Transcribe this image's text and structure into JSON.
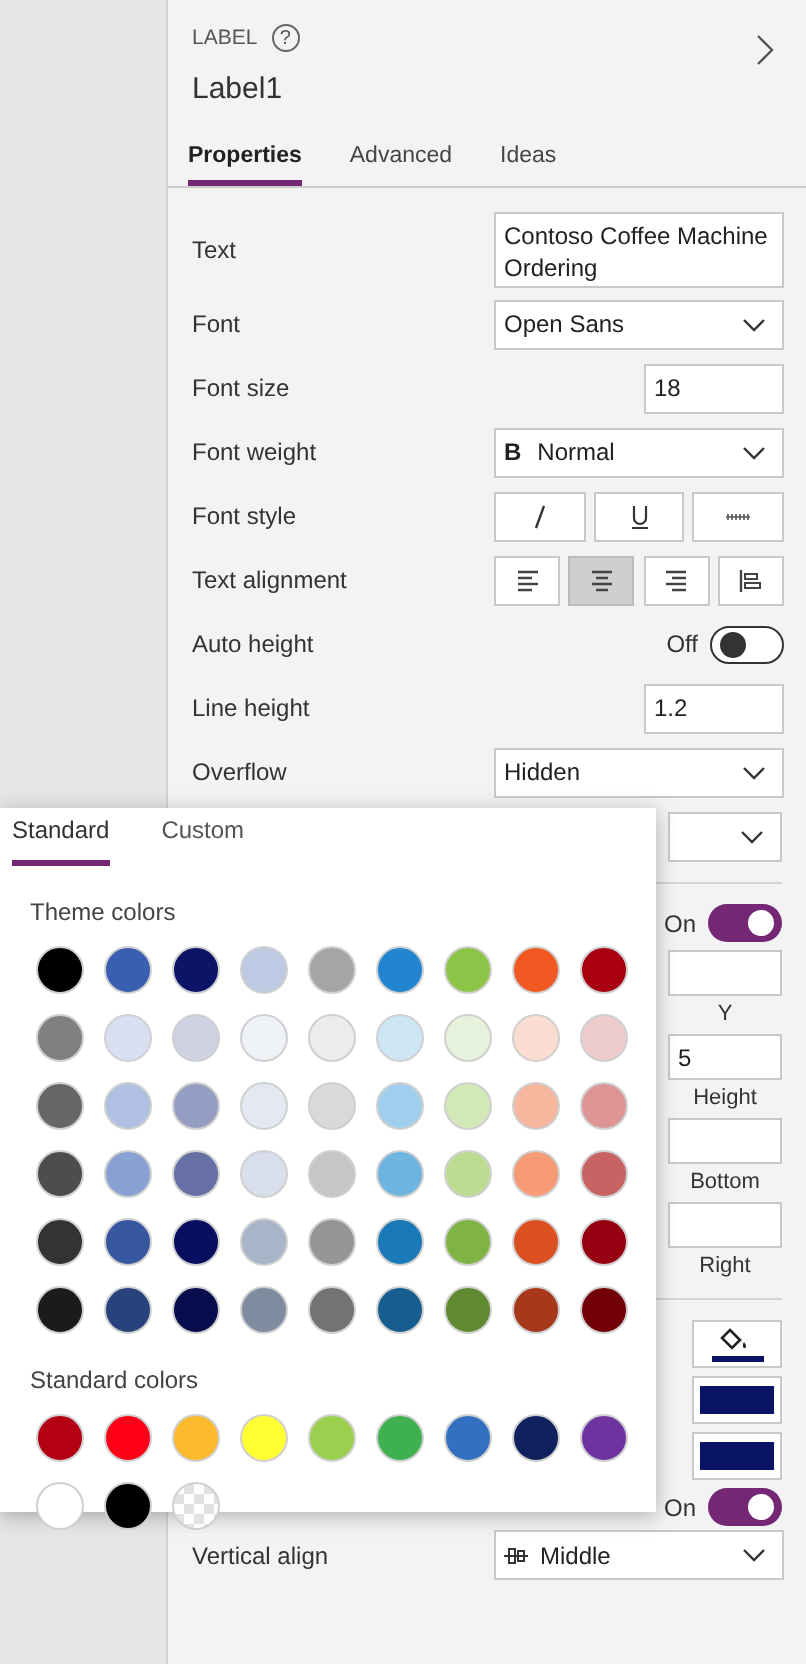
{
  "header": {
    "type_label": "LABEL",
    "help": "?",
    "name": "Label1"
  },
  "tabs": [
    {
      "label": "Properties",
      "selected": true
    },
    {
      "label": "Advanced",
      "selected": false
    },
    {
      "label": "Ideas",
      "selected": false
    }
  ],
  "properties": [
    {
      "kind": "textarea",
      "label": "Text",
      "value": "Contoso Coffee Machine Ordering"
    },
    {
      "kind": "dropdown",
      "label": "Font",
      "value": "Open Sans"
    },
    {
      "kind": "number",
      "label": "Font size",
      "value": "18"
    },
    {
      "kind": "weight",
      "label": "Font weight",
      "glyph": "B",
      "value": "Normal"
    },
    {
      "kind": "styles",
      "label": "Font style",
      "buttons": [
        {
          "kind": "italic"
        },
        {
          "kind": "underline"
        },
        {
          "kind": "strike"
        }
      ]
    },
    {
      "kind": "align",
      "label": "Text alignment",
      "buttons": [
        {
          "kind": "left",
          "selected": false
        },
        {
          "kind": "center",
          "selected": true
        },
        {
          "kind": "right",
          "selected": false
        },
        {
          "kind": "bar",
          "selected": false
        }
      ]
    },
    {
      "kind": "toggle",
      "label": "Auto height",
      "state": "Off",
      "on": false
    },
    {
      "kind": "number",
      "label": "Line height",
      "value": "1.2"
    },
    {
      "kind": "dropdown",
      "label": "Overflow",
      "value": "Hidden"
    }
  ],
  "lower_controls": [
    {
      "kind": "dropdown"
    },
    {
      "kind": "divider"
    },
    {
      "kind": "toggle",
      "state": "On",
      "on": true
    },
    {
      "kind": "field",
      "caption": "Y"
    },
    {
      "kind": "field",
      "value": "5",
      "caption": "Height"
    },
    {
      "kind": "field",
      "caption": "Bottom"
    },
    {
      "kind": "field",
      "caption": "Right"
    },
    {
      "kind": "divider"
    },
    {
      "kind": "fill",
      "color": "#0a1466"
    },
    {
      "kind": "swatch",
      "color": "#0a1466"
    },
    {
      "kind": "swatch",
      "color": "#0a1466"
    },
    {
      "kind": "toggle",
      "state": "On",
      "on": true
    }
  ],
  "vertical_align": {
    "label": "Vertical align",
    "value": "Middle"
  },
  "color_picker": {
    "tabs": [
      {
        "label": "Standard",
        "selected": true
      },
      {
        "label": "Custom",
        "selected": false
      }
    ],
    "theme_heading": "Theme colors",
    "theme_colors": [
      {
        "color": "#000000"
      },
      {
        "color": "#3a5fb0"
      },
      {
        "color": "#0b1466"
      },
      {
        "color": "#bccbe3"
      },
      {
        "color": "#a5a5a5"
      },
      {
        "color": "#2185d0"
      },
      {
        "color": "#8dc549"
      },
      {
        "color": "#f25822"
      },
      {
        "color": "#a80011"
      },
      {
        "color": "#808080"
      },
      {
        "color": "#d8dff0"
      },
      {
        "color": "#cdd1e2"
      },
      {
        "color": "#eef2f7"
      },
      {
        "color": "#ececec"
      },
      {
        "color": "#cde6f3"
      },
      {
        "color": "#e6f2dc"
      },
      {
        "color": "#fbdcd0"
      },
      {
        "color": "#edcbcb"
      },
      {
        "color": "#666666"
      },
      {
        "color": "#b0c0e2"
      },
      {
        "color": "#969dc3"
      },
      {
        "color": "#e3e8f2"
      },
      {
        "color": "#d9d9d9"
      },
      {
        "color": "#9fcfec"
      },
      {
        "color": "#d2e8b7"
      },
      {
        "color": "#f6b79e"
      },
      {
        "color": "#dc9494"
      },
      {
        "color": "#4d4d4d"
      },
      {
        "color": "#88a0d2"
      },
      {
        "color": "#6670a4"
      },
      {
        "color": "#d8deeb"
      },
      {
        "color": "#c6c6c6"
      },
      {
        "color": "#6db5e0"
      },
      {
        "color": "#bcdc91"
      },
      {
        "color": "#f59a73"
      },
      {
        "color": "#c86363"
      },
      {
        "color": "#333333"
      },
      {
        "color": "#3756a0"
      },
      {
        "color": "#090f60"
      },
      {
        "color": "#a6b5c8"
      },
      {
        "color": "#959595"
      },
      {
        "color": "#1a7ab8"
      },
      {
        "color": "#7fb343"
      },
      {
        "color": "#db4f20"
      },
      {
        "color": "#970010"
      },
      {
        "color": "#1b1b1b"
      },
      {
        "color": "#27427d"
      },
      {
        "color": "#060c4c"
      },
      {
        "color": "#7f8b9e"
      },
      {
        "color": "#737373"
      },
      {
        "color": "#155e8f"
      },
      {
        "color": "#5f8a32"
      },
      {
        "color": "#a7391a"
      },
      {
        "color": "#730008"
      }
    ],
    "standard_heading": "Standard colors",
    "standard_colors": [
      {
        "kind": "solid",
        "color": "#b30013"
      },
      {
        "kind": "solid",
        "color": "#ff0019"
      },
      {
        "kind": "solid",
        "color": "#fcbb2c"
      },
      {
        "kind": "solid",
        "color": "#ffff33"
      },
      {
        "kind": "solid",
        "color": "#9bd14e"
      },
      {
        "kind": "solid",
        "color": "#3eb050"
      },
      {
        "kind": "solid",
        "color": "#3470c2"
      },
      {
        "kind": "solid",
        "color": "#0f215f"
      },
      {
        "kind": "solid",
        "color": "#6f33a0"
      },
      {
        "kind": "solid",
        "color": "#ffffff"
      },
      {
        "kind": "solid",
        "color": "#000000"
      },
      {
        "kind": "transparent"
      }
    ]
  }
}
